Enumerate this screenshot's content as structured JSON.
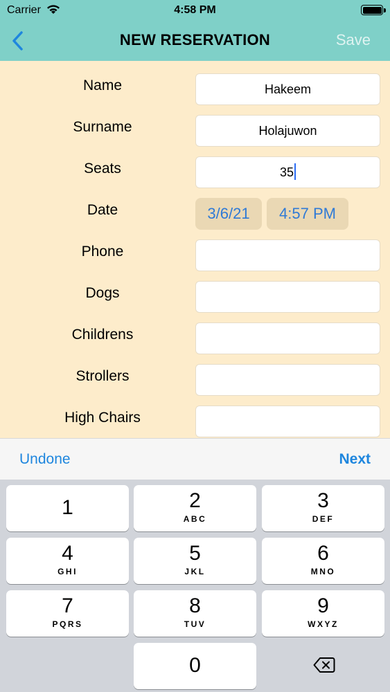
{
  "status": {
    "carrier": "Carrier",
    "time": "4:58 PM",
    "wifi_icon": "wifi-icon",
    "battery_icon": "battery-icon"
  },
  "nav": {
    "back_icon": "chevron-left-icon",
    "title": "NEW RESERVATION",
    "save_label": "Save"
  },
  "form": {
    "name": {
      "label": "Name",
      "value": "Hakeem"
    },
    "surname": {
      "label": "Surname",
      "value": "Holajuwon"
    },
    "seats": {
      "label": "Seats",
      "value": "35"
    },
    "date": {
      "label": "Date",
      "date_value": "3/6/21",
      "time_value": "4:57 PM"
    },
    "phone": {
      "label": "Phone",
      "value": ""
    },
    "dogs": {
      "label": "Dogs",
      "value": ""
    },
    "childrens": {
      "label": "Childrens",
      "value": ""
    },
    "strollers": {
      "label": "Strollers",
      "value": ""
    },
    "high_chairs": {
      "label": "High Chairs",
      "value": ""
    }
  },
  "toolbar": {
    "undone_label": "Undone",
    "next_label": "Next"
  },
  "keypad": {
    "keys": [
      {
        "digit": "1",
        "letters": ""
      },
      {
        "digit": "2",
        "letters": "ABC"
      },
      {
        "digit": "3",
        "letters": "DEF"
      },
      {
        "digit": "4",
        "letters": "GHI"
      },
      {
        "digit": "5",
        "letters": "JKL"
      },
      {
        "digit": "6",
        "letters": "MNO"
      },
      {
        "digit": "7",
        "letters": "PQRS"
      },
      {
        "digit": "8",
        "letters": "TUV"
      },
      {
        "digit": "9",
        "letters": "WXYZ"
      },
      {
        "digit": "0",
        "letters": ""
      }
    ],
    "delete_icon": "backspace-icon"
  },
  "colors": {
    "header_bg": "#7fd0c8",
    "form_bg": "#fdeccb",
    "accent_blue": "#1e86de",
    "keyboard_bg": "#d1d4da"
  }
}
